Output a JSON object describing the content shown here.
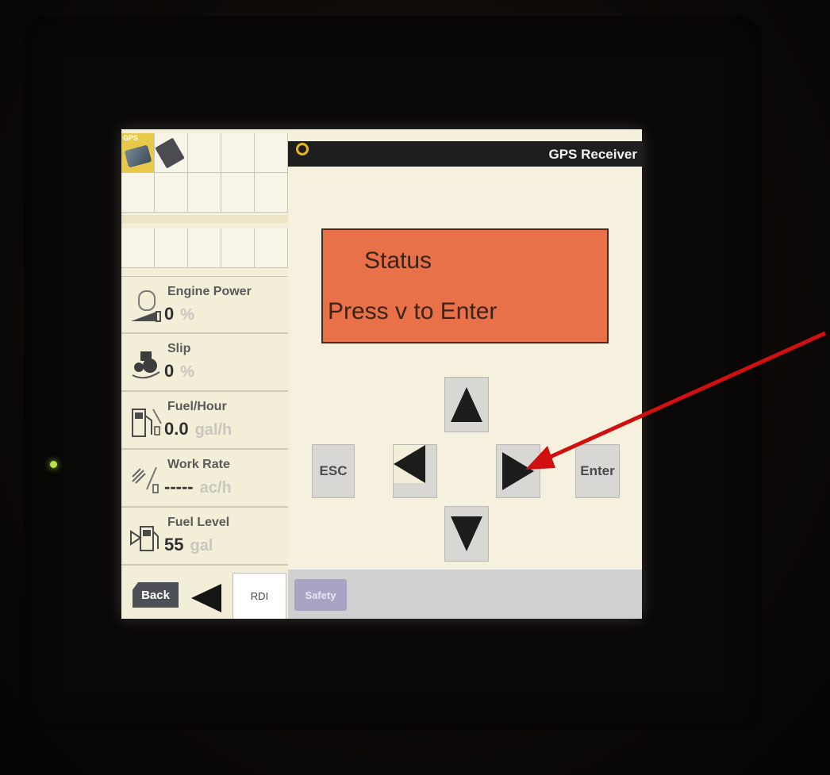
{
  "header": {
    "title": "GPS Receiver"
  },
  "tiles": {
    "gps_label": "GPS"
  },
  "status": {
    "line1": "Status",
    "line2": "Press v to Enter"
  },
  "keys": {
    "esc": "ESC",
    "enter": "Enter"
  },
  "readouts": [
    {
      "label": "Engine Power",
      "value": "0",
      "unit": "%"
    },
    {
      "label": "Slip",
      "value": "0",
      "unit": "%"
    },
    {
      "label": "Fuel/Hour",
      "value": "0.0",
      "unit": "gal/h"
    },
    {
      "label": "Work Rate",
      "value": "-----",
      "unit": "ac/h"
    },
    {
      "label": "Fuel Level",
      "value": "55",
      "unit": "gal"
    }
  ],
  "bottom": {
    "back": "Back",
    "rdi": "RDI",
    "safety": "Safety"
  },
  "colors": {
    "status_bg": "#e8714a",
    "annotation_arrow": "#d01010"
  }
}
